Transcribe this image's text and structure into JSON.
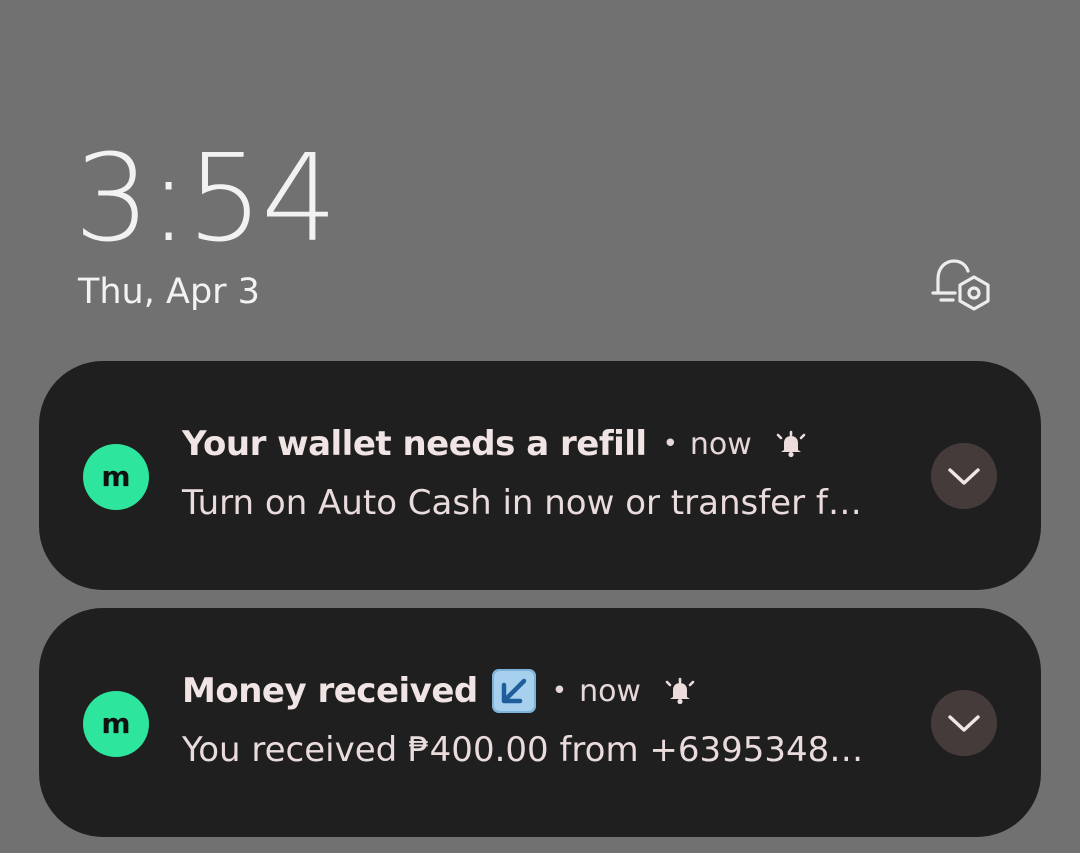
{
  "lockscreen": {
    "time": "3:54",
    "date": "Thu, Apr 3",
    "settings_icon": "notification-settings-icon"
  },
  "notifications": [
    {
      "app_icon": "maya-app-icon",
      "app_letter": "m",
      "title": "Your wallet needs a refill",
      "separator": "•",
      "time": "now",
      "alert_icon": "alarm-bell-icon",
      "body": "Turn on Auto Cash in now or transfer f…",
      "expand_icon": "chevron-down-icon"
    },
    {
      "app_icon": "maya-app-icon",
      "app_letter": "m",
      "title": "Money received",
      "emoji_icon": "arrow-down-left-emoji-icon",
      "separator": "•",
      "time": "now",
      "alert_icon": "alarm-bell-icon",
      "body": "You received ₱400.00 from +6395348…",
      "expand_icon": "chevron-down-icon"
    }
  ],
  "colors": {
    "background": "#717171",
    "card": "#1f1f1f",
    "app_icon": "#2ee59d",
    "expand_button": "#463b3b"
  }
}
